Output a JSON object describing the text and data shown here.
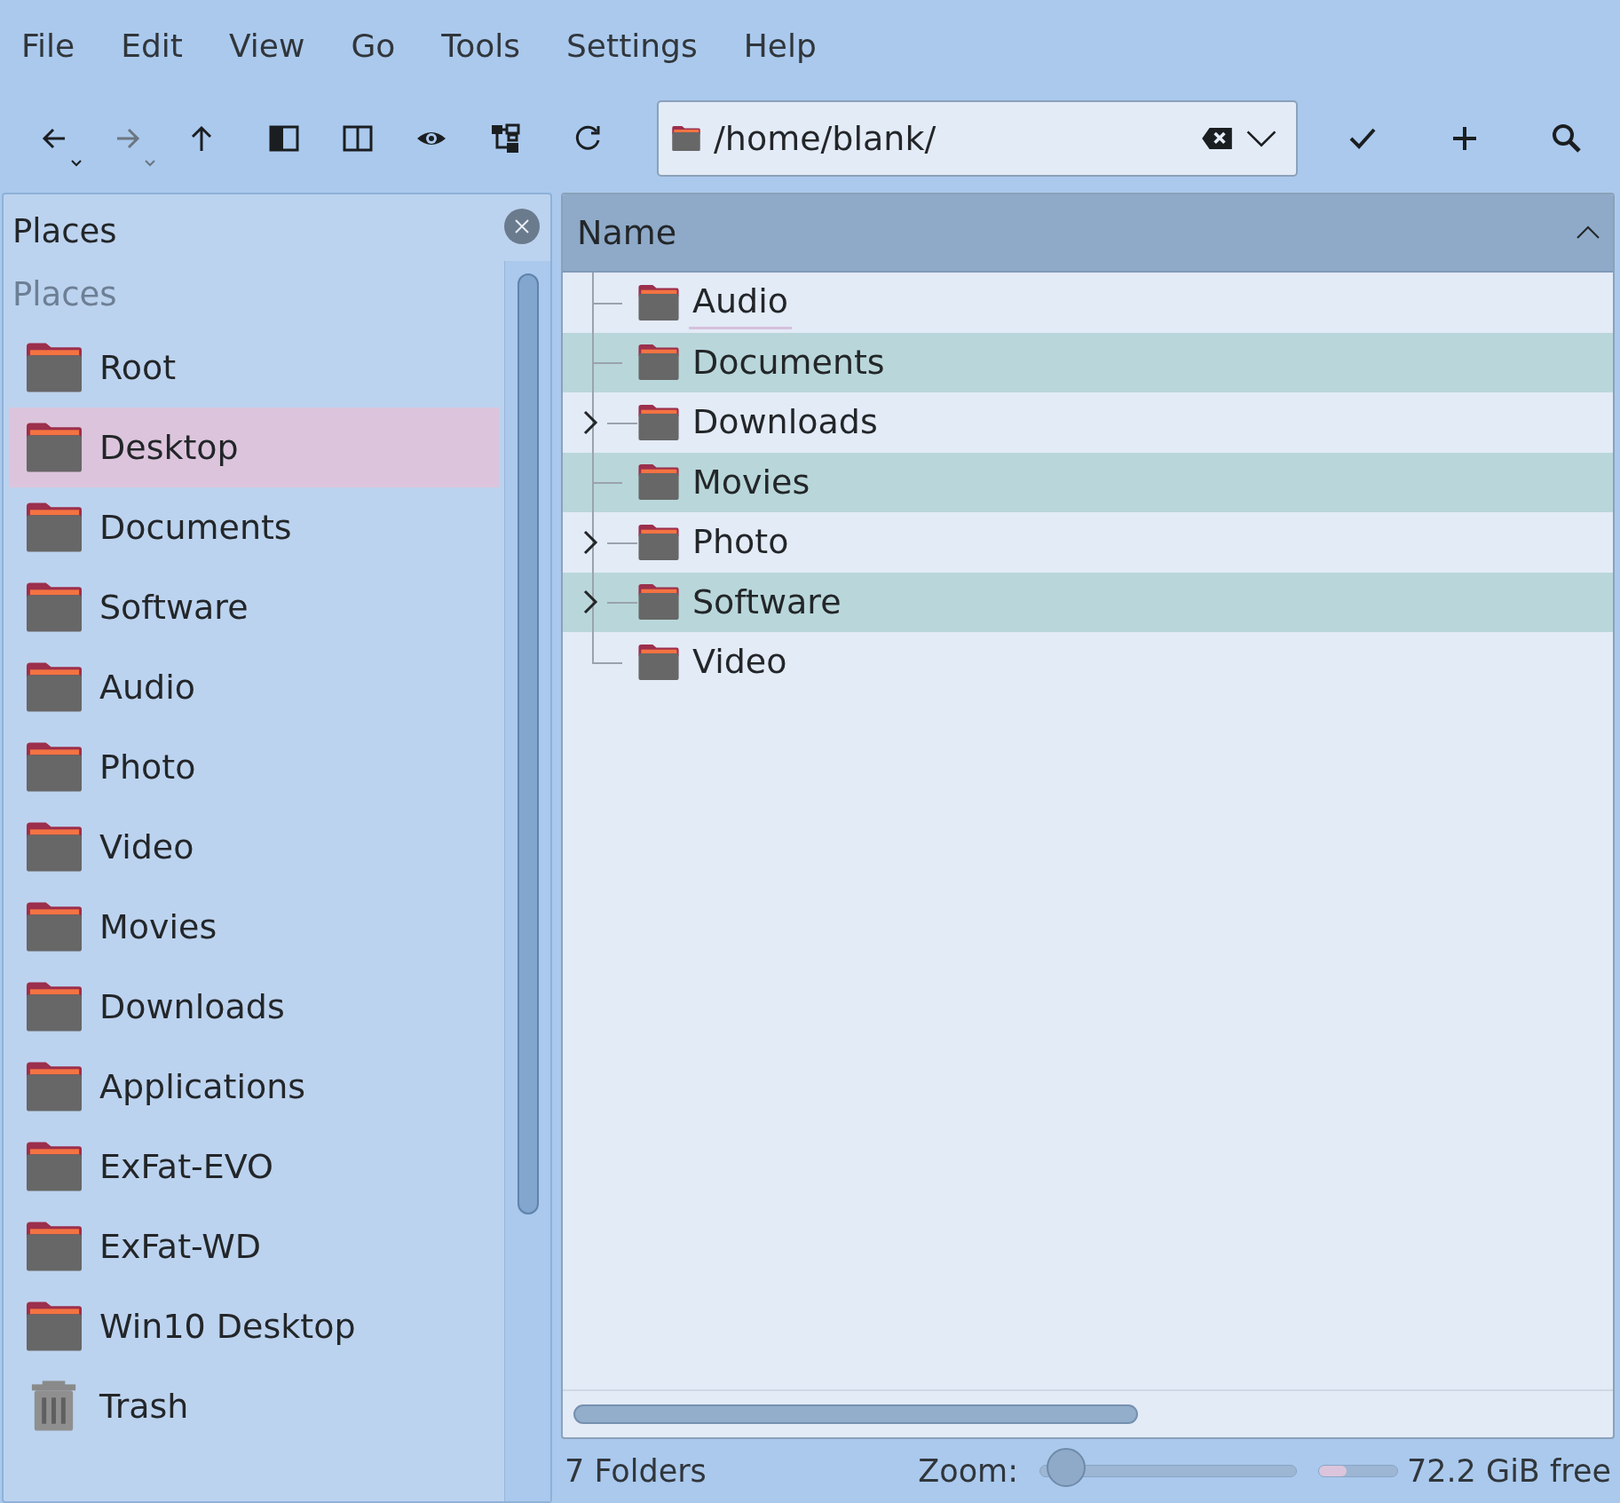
{
  "menu": [
    "File",
    "Edit",
    "View",
    "Go",
    "Tools",
    "Settings",
    "Help"
  ],
  "toolbar": [
    {
      "kind": "back",
      "disabled": false
    },
    {
      "kind": "forward",
      "disabled": true
    },
    {
      "kind": "up",
      "disabled": false
    },
    {
      "kind": "sidebar",
      "disabled": false
    },
    {
      "kind": "split",
      "disabled": false
    },
    {
      "kind": "preview",
      "disabled": false
    },
    {
      "kind": "tree",
      "disabled": false
    },
    {
      "kind": "reload",
      "disabled": false
    }
  ],
  "location": {
    "value": "/home/blank/"
  },
  "actions": [
    {
      "kind": "apply"
    },
    {
      "kind": "add"
    },
    {
      "kind": "search"
    }
  ],
  "places": {
    "title": "Places",
    "section": "Places",
    "items": [
      {
        "label": "Root",
        "kind": "folder",
        "selected": false
      },
      {
        "label": "Desktop",
        "kind": "folder",
        "selected": true
      },
      {
        "label": "Documents",
        "kind": "folder",
        "selected": false
      },
      {
        "label": "Software",
        "kind": "folder",
        "selected": false
      },
      {
        "label": "Audio",
        "kind": "folder",
        "selected": false
      },
      {
        "label": "Photo",
        "kind": "folder",
        "selected": false
      },
      {
        "label": "Video",
        "kind": "folder",
        "selected": false
      },
      {
        "label": "Movies",
        "kind": "folder",
        "selected": false
      },
      {
        "label": "Downloads",
        "kind": "folder",
        "selected": false
      },
      {
        "label": "Applications",
        "kind": "folder",
        "selected": false
      },
      {
        "label": "ExFat-EVO",
        "kind": "folder",
        "selected": false
      },
      {
        "label": "ExFat-WD",
        "kind": "folder",
        "selected": false
      },
      {
        "label": "Win10 Desktop",
        "kind": "folder",
        "selected": false
      },
      {
        "label": "Trash",
        "kind": "trash",
        "selected": false
      }
    ]
  },
  "tree": {
    "column": "Name",
    "rows": [
      {
        "label": "Audio",
        "expandable": false,
        "focused": true
      },
      {
        "label": "Documents",
        "expandable": false,
        "focused": false
      },
      {
        "label": "Downloads",
        "expandable": true,
        "focused": false
      },
      {
        "label": "Movies",
        "expandable": false,
        "focused": false
      },
      {
        "label": "Photo",
        "expandable": true,
        "focused": false
      },
      {
        "label": "Software",
        "expandable": true,
        "focused": false
      },
      {
        "label": "Video",
        "expandable": false,
        "focused": false
      }
    ]
  },
  "status": {
    "summary": "7 Folders",
    "zoom_label": "Zoom:",
    "zoom": {
      "level": 0.1
    },
    "disk": {
      "level": 0.35
    },
    "free": "72.2 GiB free"
  }
}
